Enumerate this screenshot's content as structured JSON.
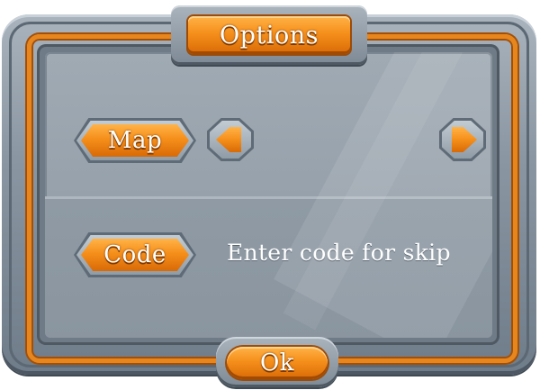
{
  "dialog": {
    "title": "Options",
    "map_label": "Map",
    "code_label": "Code",
    "code_hint": "Enter code for skip",
    "ok_label": "Ok"
  },
  "icons": {
    "prev": "arrow-left-icon",
    "next": "arrow-right-icon"
  },
  "colors": {
    "button_orange": "#f58f1b",
    "frame_stone": "#8a96a2",
    "rail_orange": "#e7861c",
    "glass": "#98a2ac"
  }
}
